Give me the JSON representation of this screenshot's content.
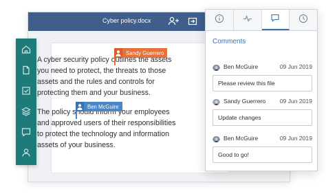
{
  "document": {
    "title": "Cyber policy.docx",
    "paragraph1": [
      "A cyber security policy outlines the assets",
      "you need to protect, the threats to those",
      "assets and the rules and controls for",
      "protecting them and your business."
    ],
    "paragraph2": [
      "The policy should inform your employees",
      "and approved users of their responsibilities",
      "to protect the technology and information",
      "assets of your business."
    ]
  },
  "cursors": [
    {
      "name": "Sandy Guerrero",
      "color": "#e8703a"
    },
    {
      "name": "Ben McGuire",
      "color": "#4a86c8"
    }
  ],
  "toolbar_icons": [
    "add-user-icon",
    "export-icon"
  ],
  "sidebar_icons": [
    "home-icon",
    "document-icon",
    "checklist-icon",
    "layers-icon",
    "chat-icon",
    "user-icon"
  ],
  "panel": {
    "tabs": [
      "info-icon",
      "activity-icon",
      "comments-icon",
      "history-icon"
    ],
    "active_tab": "comments-icon",
    "title": "Comments",
    "comments": [
      {
        "author": "Ben McGuire",
        "date": "09 Jun 2019",
        "text": "Please review this file"
      },
      {
        "author": "Sandy Guerrero",
        "date": "09 Jun 2019",
        "text": "Update changes"
      },
      {
        "author": "Ben McGuire",
        "date": "09 Jun 2019",
        "text": "Good to go!"
      }
    ]
  },
  "colors": {
    "titlebar": "#3f5e8c",
    "sidebar": "#1e7b7a",
    "accent": "#3f6fb0"
  }
}
